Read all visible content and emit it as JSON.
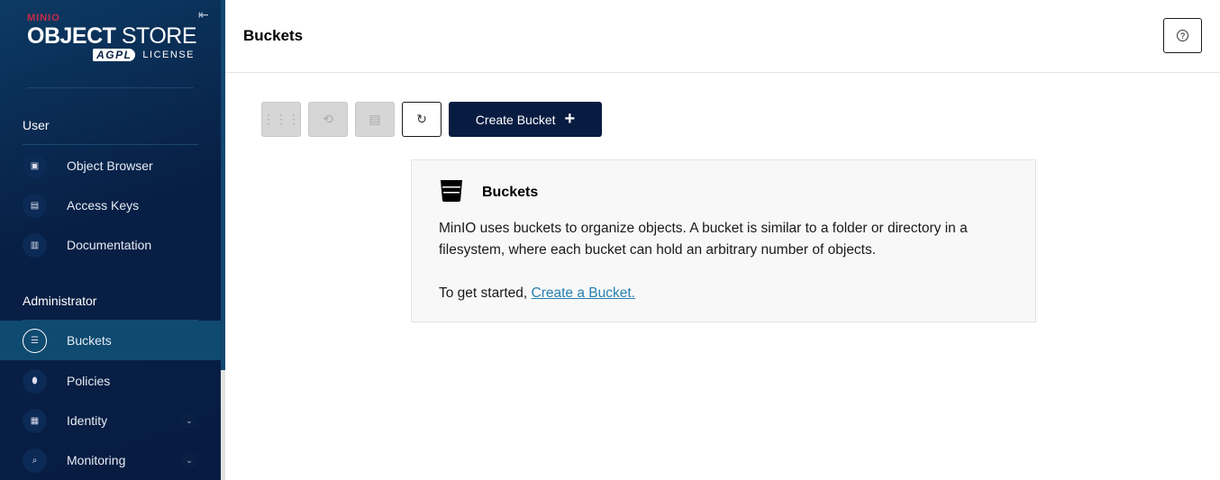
{
  "sidebar": {
    "logo": {
      "brand": "MINIO",
      "product_bold": "OBJECT",
      "product_light": "STORE",
      "agpl": "AGPL",
      "license": "LICENSE"
    },
    "sections": [
      {
        "title": "User",
        "items": [
          {
            "label": "Object Browser",
            "icon": "object-browser-icon"
          },
          {
            "label": "Access Keys",
            "icon": "access-keys-icon"
          },
          {
            "label": "Documentation",
            "icon": "documentation-icon"
          }
        ]
      },
      {
        "title": "Administrator",
        "items": [
          {
            "label": "Buckets",
            "icon": "bucket-icon",
            "active": true
          },
          {
            "label": "Policies",
            "icon": "policies-icon"
          },
          {
            "label": "Identity",
            "icon": "identity-icon",
            "expandable": true
          },
          {
            "label": "Monitoring",
            "icon": "monitoring-icon",
            "expandable": true
          }
        ]
      }
    ]
  },
  "header": {
    "title": "Buckets",
    "help_icon": "help-icon"
  },
  "toolbar": {
    "create_label": "Create Bucket",
    "create_icon": "plus-icon"
  },
  "card": {
    "title": "Buckets",
    "text": "MinIO uses buckets to organize objects. A bucket is similar to a folder or directory in a filesystem, where each bucket can hold an arbitrary number of objects.",
    "started_prefix": "To get started, ",
    "started_link": "Create a Bucket."
  },
  "colors": {
    "sidebar": "#081f45",
    "active": "#0f4a70",
    "primary": "#081c42",
    "link": "#2781b0",
    "brand": "#c72c48"
  }
}
